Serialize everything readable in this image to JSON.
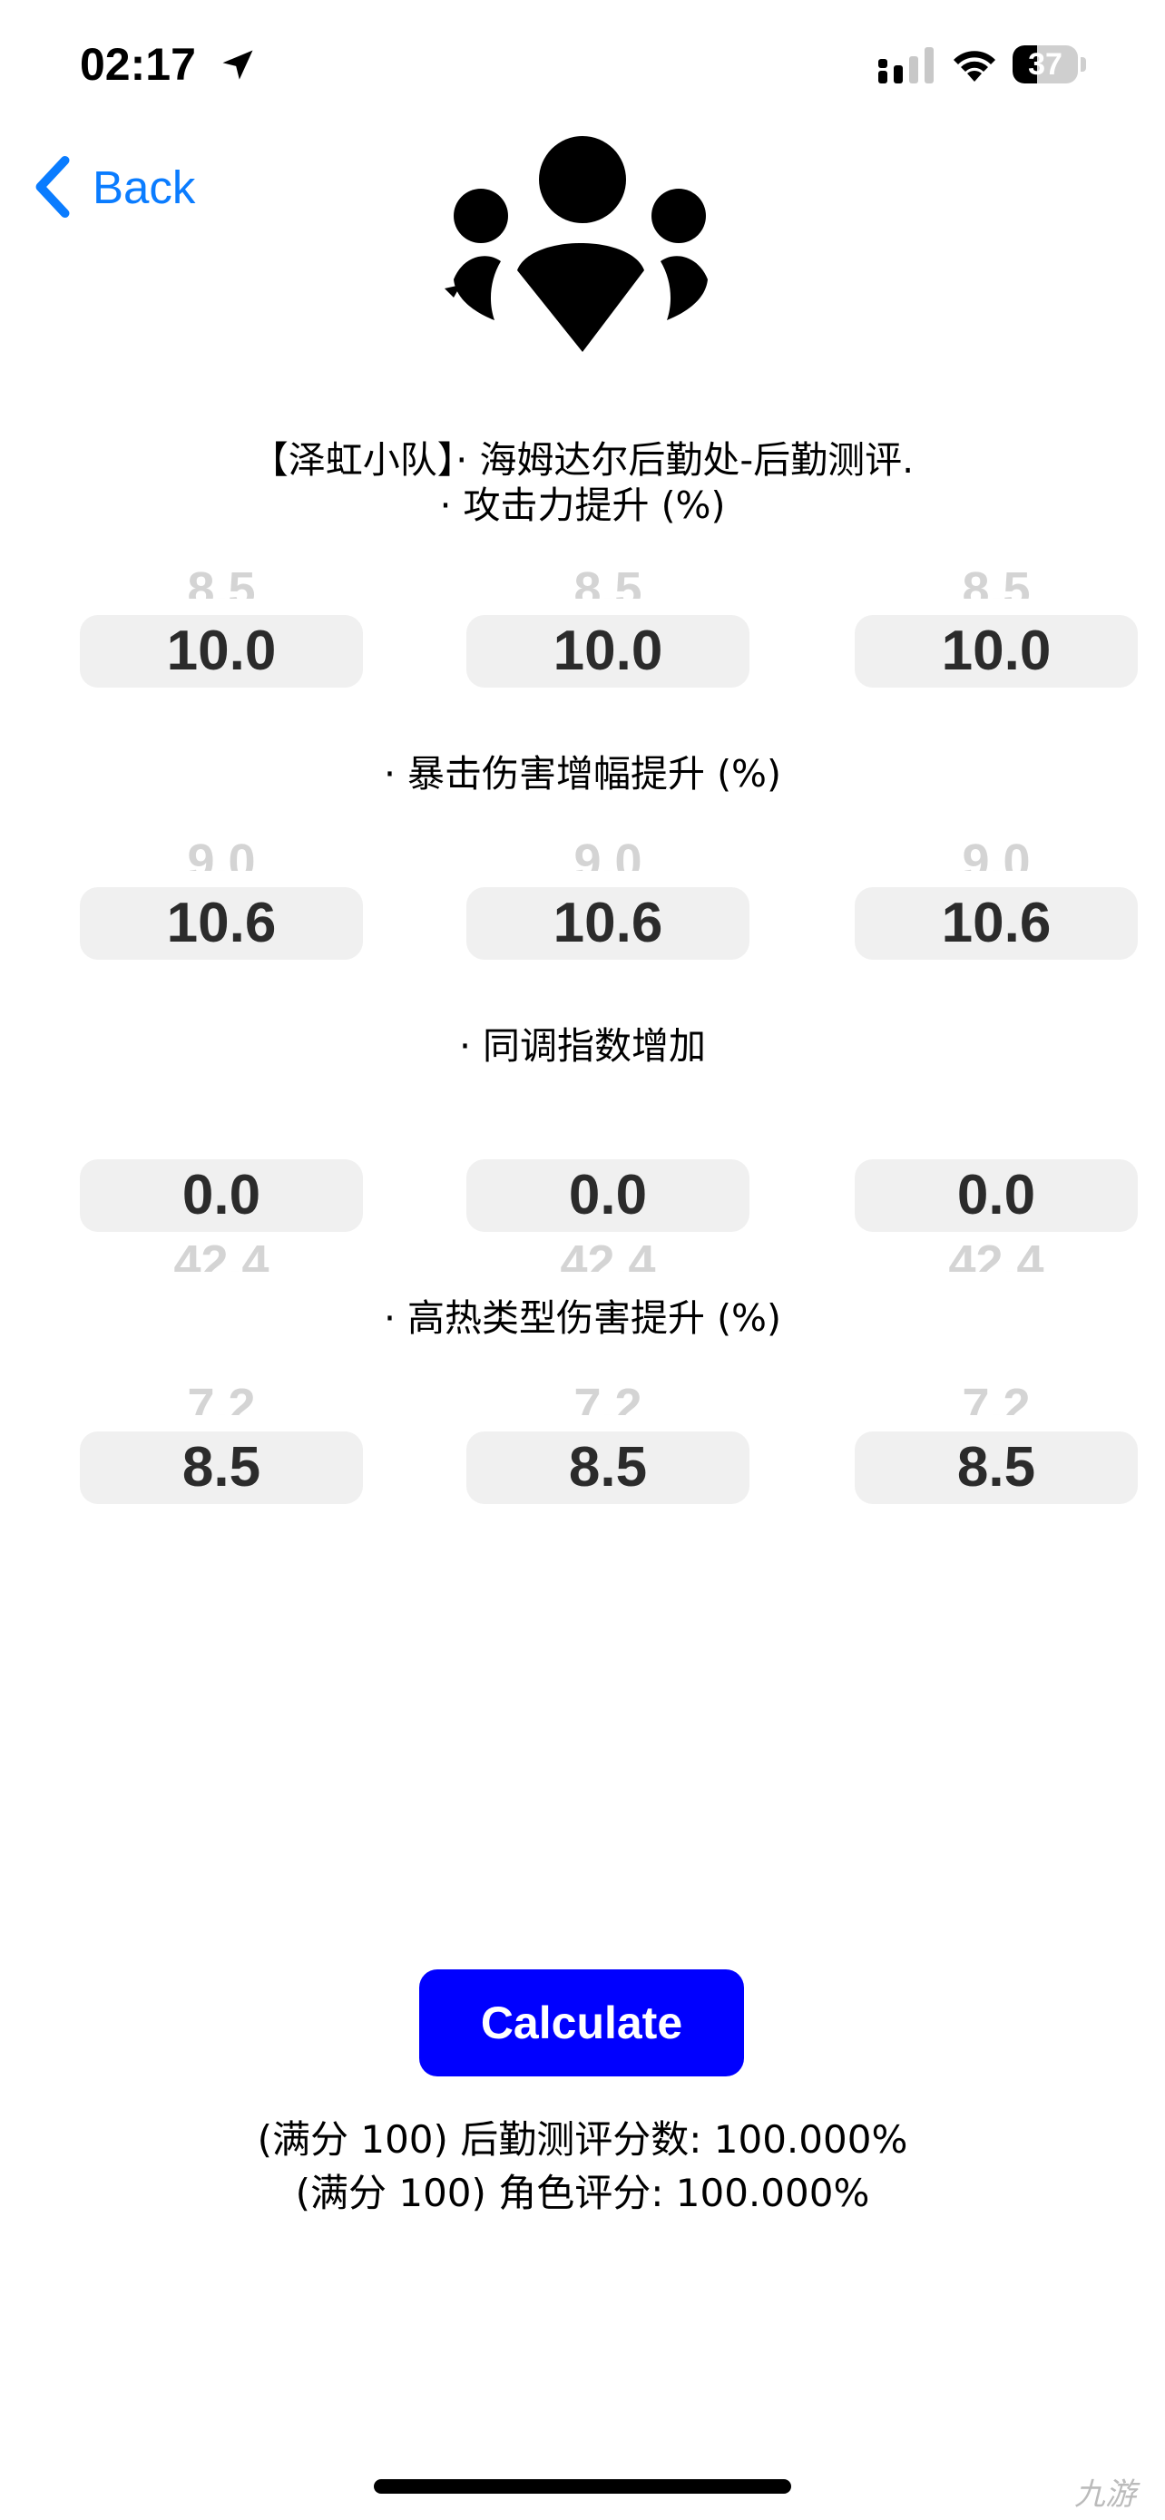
{
  "status_bar": {
    "time": "02:17",
    "battery": "37",
    "battery_level": 0.37
  },
  "nav": {
    "back_label": "Back"
  },
  "header": {
    "title_line1": "【泽虹小队】· 海姆达尔后勤处-后勤测评.",
    "title_line2": "· 攻击力提升 (%)"
  },
  "sections": [
    {
      "label": "· 攻击力提升 (%)",
      "pickers": [
        {
          "value": "10.0",
          "above": "8.5",
          "below": ""
        },
        {
          "value": "10.0",
          "above": "8.5",
          "below": ""
        },
        {
          "value": "10.0",
          "above": "8.5",
          "below": ""
        }
      ]
    },
    {
      "label": "· 暴击伤害增幅提升 (%)",
      "pickers": [
        {
          "value": "10.6",
          "above": "9.0",
          "below": ""
        },
        {
          "value": "10.6",
          "above": "9.0",
          "below": ""
        },
        {
          "value": "10.6",
          "above": "9.0",
          "below": ""
        }
      ]
    },
    {
      "label": "· 同调指数增加",
      "pickers": [
        {
          "value": "0.0",
          "above": "",
          "below": "42.4"
        },
        {
          "value": "0.0",
          "above": "",
          "below": "42.4"
        },
        {
          "value": "0.0",
          "above": "",
          "below": "42.4"
        }
      ]
    },
    {
      "label": "· 高热类型伤害提升 (%)",
      "pickers": [
        {
          "value": "8.5",
          "above": "7.2",
          "below": ""
        },
        {
          "value": "8.5",
          "above": "7.2",
          "below": ""
        },
        {
          "value": "8.5",
          "above": "7.2",
          "below": ""
        }
      ]
    }
  ],
  "actions": {
    "calculate_label": "Calculate"
  },
  "results": {
    "logistics_score": "(满分 100) 后勤测评分数: 100.000%",
    "character_score": "(满分 100) 角色评分: 100.000%"
  },
  "watermark": "九游",
  "colors": {
    "accent_blue": "#0a7cff",
    "button_blue": "#0000ff",
    "picker_bg": "#f0f0f0",
    "ghost_text": "#d4d4d4"
  },
  "icons": {
    "location": "location-arrow-icon",
    "signal": "cellular-signal-icon",
    "wifi": "wifi-icon",
    "battery": "battery-icon",
    "back": "chevron-left-icon",
    "logo": "group-people-icon"
  }
}
